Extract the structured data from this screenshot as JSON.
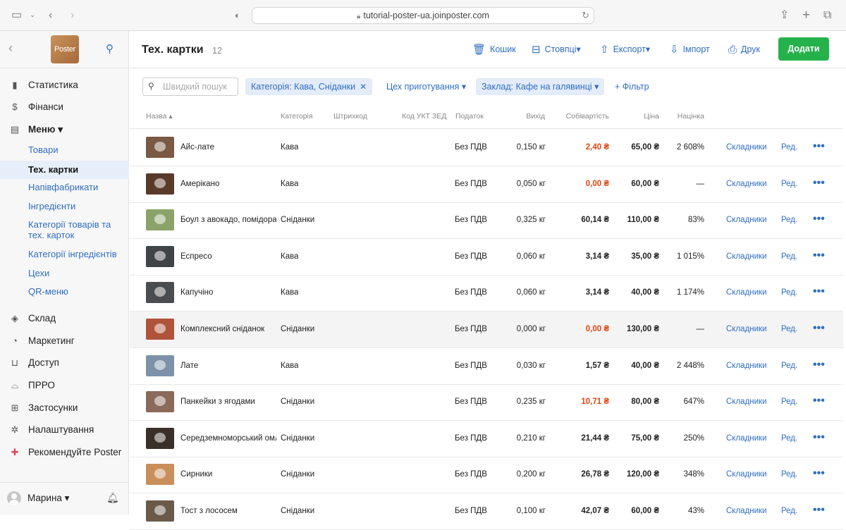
{
  "browser": {
    "url": "tutorial-poster-ua.joinposter.com"
  },
  "sidebar": {
    "logo": "Poster",
    "items": [
      {
        "label": "Статистика",
        "icon": "bar-chart-icon"
      },
      {
        "label": "Фінанси",
        "icon": "dollar-icon"
      },
      {
        "label": "Меню ▾",
        "icon": "document-icon"
      },
      {
        "label": "Склад",
        "icon": "layers-icon"
      },
      {
        "label": "Маркетинг",
        "icon": "pie-icon"
      },
      {
        "label": "Доступ",
        "icon": "lock-icon"
      },
      {
        "label": "ПРРО",
        "icon": "register-icon"
      },
      {
        "label": "Застосунки",
        "icon": "grid-icon"
      },
      {
        "label": "Налаштування",
        "icon": "gear-icon"
      },
      {
        "label": "Рекомендуйте Poster",
        "icon": "gift-icon"
      }
    ],
    "menu_sub": [
      "Товари",
      "Тех. картки",
      "Напівфабрикати",
      "Інгредієнти",
      "Категорії товарів та тех. карток",
      "Категорії інгредієнтів",
      "Цехи",
      "QR-меню"
    ],
    "user": "Марина ▾"
  },
  "header": {
    "title": "Тех. картки",
    "count": "12",
    "toolbar": {
      "trash": "Кошик",
      "columns": "Стовпці▾",
      "export": "Експорт▾",
      "import": "Імпорт",
      "print": "Друк",
      "add": "Додати"
    }
  },
  "filters": {
    "search_placeholder": "Швидкий пошук",
    "chip_category": "Категорія: Кава, Сніданки",
    "workshop": "Цех приготування ▾",
    "chip_venue": "Заклад: Кафе на галявинці ▾",
    "add_filter": "+ Фільтр"
  },
  "table": {
    "columns": [
      "Назва ▴",
      "Категорія",
      "Штрихкод",
      "Код УКТ ЗЕД",
      "Податок",
      "Вихід",
      "Собівартість",
      "Ціна",
      "Націнка"
    ],
    "link_ingredients": "Складники",
    "link_edit": "Ред.",
    "rows": [
      {
        "name": "Айс-лате",
        "category": "Кава",
        "tax": "Без ПДВ",
        "output": "0,150 кг",
        "cost": "2,40 ₴",
        "cost_red": true,
        "price": "65,00 ₴",
        "markup": "2 608%",
        "thumb": "#7a5a44"
      },
      {
        "name": "Амерікано",
        "category": "Кава",
        "tax": "Без ПДВ",
        "output": "0,050 кг",
        "cost": "0,00 ₴",
        "cost_red": true,
        "price": "60,00 ₴",
        "markup": "—",
        "thumb": "#5a3b2a"
      },
      {
        "name": "Боул з авокадо, помідорами",
        "category": "Сніданки",
        "tax": "Без ПДВ",
        "output": "0,325 кг",
        "cost": "60,14 ₴",
        "cost_red": false,
        "price": "110,00 ₴",
        "markup": "83%",
        "thumb": "#8aa36a"
      },
      {
        "name": "Еспресо",
        "category": "Кава",
        "tax": "Без ПДВ",
        "output": "0,060 кг",
        "cost": "3,14 ₴",
        "cost_red": false,
        "price": "35,00 ₴",
        "markup": "1 015%",
        "thumb": "#3f4446"
      },
      {
        "name": "Капучіно",
        "category": "Кава",
        "tax": "Без ПДВ",
        "output": "0,060 кг",
        "cost": "3,14 ₴",
        "cost_red": false,
        "price": "40,00 ₴",
        "markup": "1 174%",
        "thumb": "#4a4d50"
      },
      {
        "name": "Комплексний сніданок",
        "category": "Сніданки",
        "tax": "Без ПДВ",
        "output": "0,000 кг",
        "cost": "0,00 ₴",
        "cost_red": true,
        "price": "130,00 ₴",
        "markup": "—",
        "thumb": "#b0533b"
      },
      {
        "name": "Лате",
        "category": "Кава",
        "tax": "Без ПДВ",
        "output": "0,030 кг",
        "cost": "1,57 ₴",
        "cost_red": false,
        "price": "40,00 ₴",
        "markup": "2 448%",
        "thumb": "#7d92a8"
      },
      {
        "name": "Панкейки з ягодами",
        "category": "Сніданки",
        "tax": "Без ПДВ",
        "output": "0,235 кг",
        "cost": "10,71 ₴",
        "cost_red": true,
        "price": "80,00 ₴",
        "markup": "647%",
        "thumb": "#8a6a5a"
      },
      {
        "name": "Середземноморський омлет",
        "category": "Сніданки",
        "tax": "Без ПДВ",
        "output": "0,210 кг",
        "cost": "21,44 ₴",
        "cost_red": false,
        "price": "75,00 ₴",
        "markup": "250%",
        "thumb": "#3b2f2a"
      },
      {
        "name": "Сирники",
        "category": "Сніданки",
        "tax": "Без ПДВ",
        "output": "0,200 кг",
        "cost": "26,78 ₴",
        "cost_red": false,
        "price": "120,00 ₴",
        "markup": "348%",
        "thumb": "#c98f5a"
      },
      {
        "name": "Тост з лососем",
        "category": "Сніданки",
        "tax": "Без ПДВ",
        "output": "0,100 кг",
        "cost": "42,07 ₴",
        "cost_red": false,
        "price": "60,00 ₴",
        "markup": "43%",
        "thumb": "#6a5a4a"
      }
    ]
  }
}
